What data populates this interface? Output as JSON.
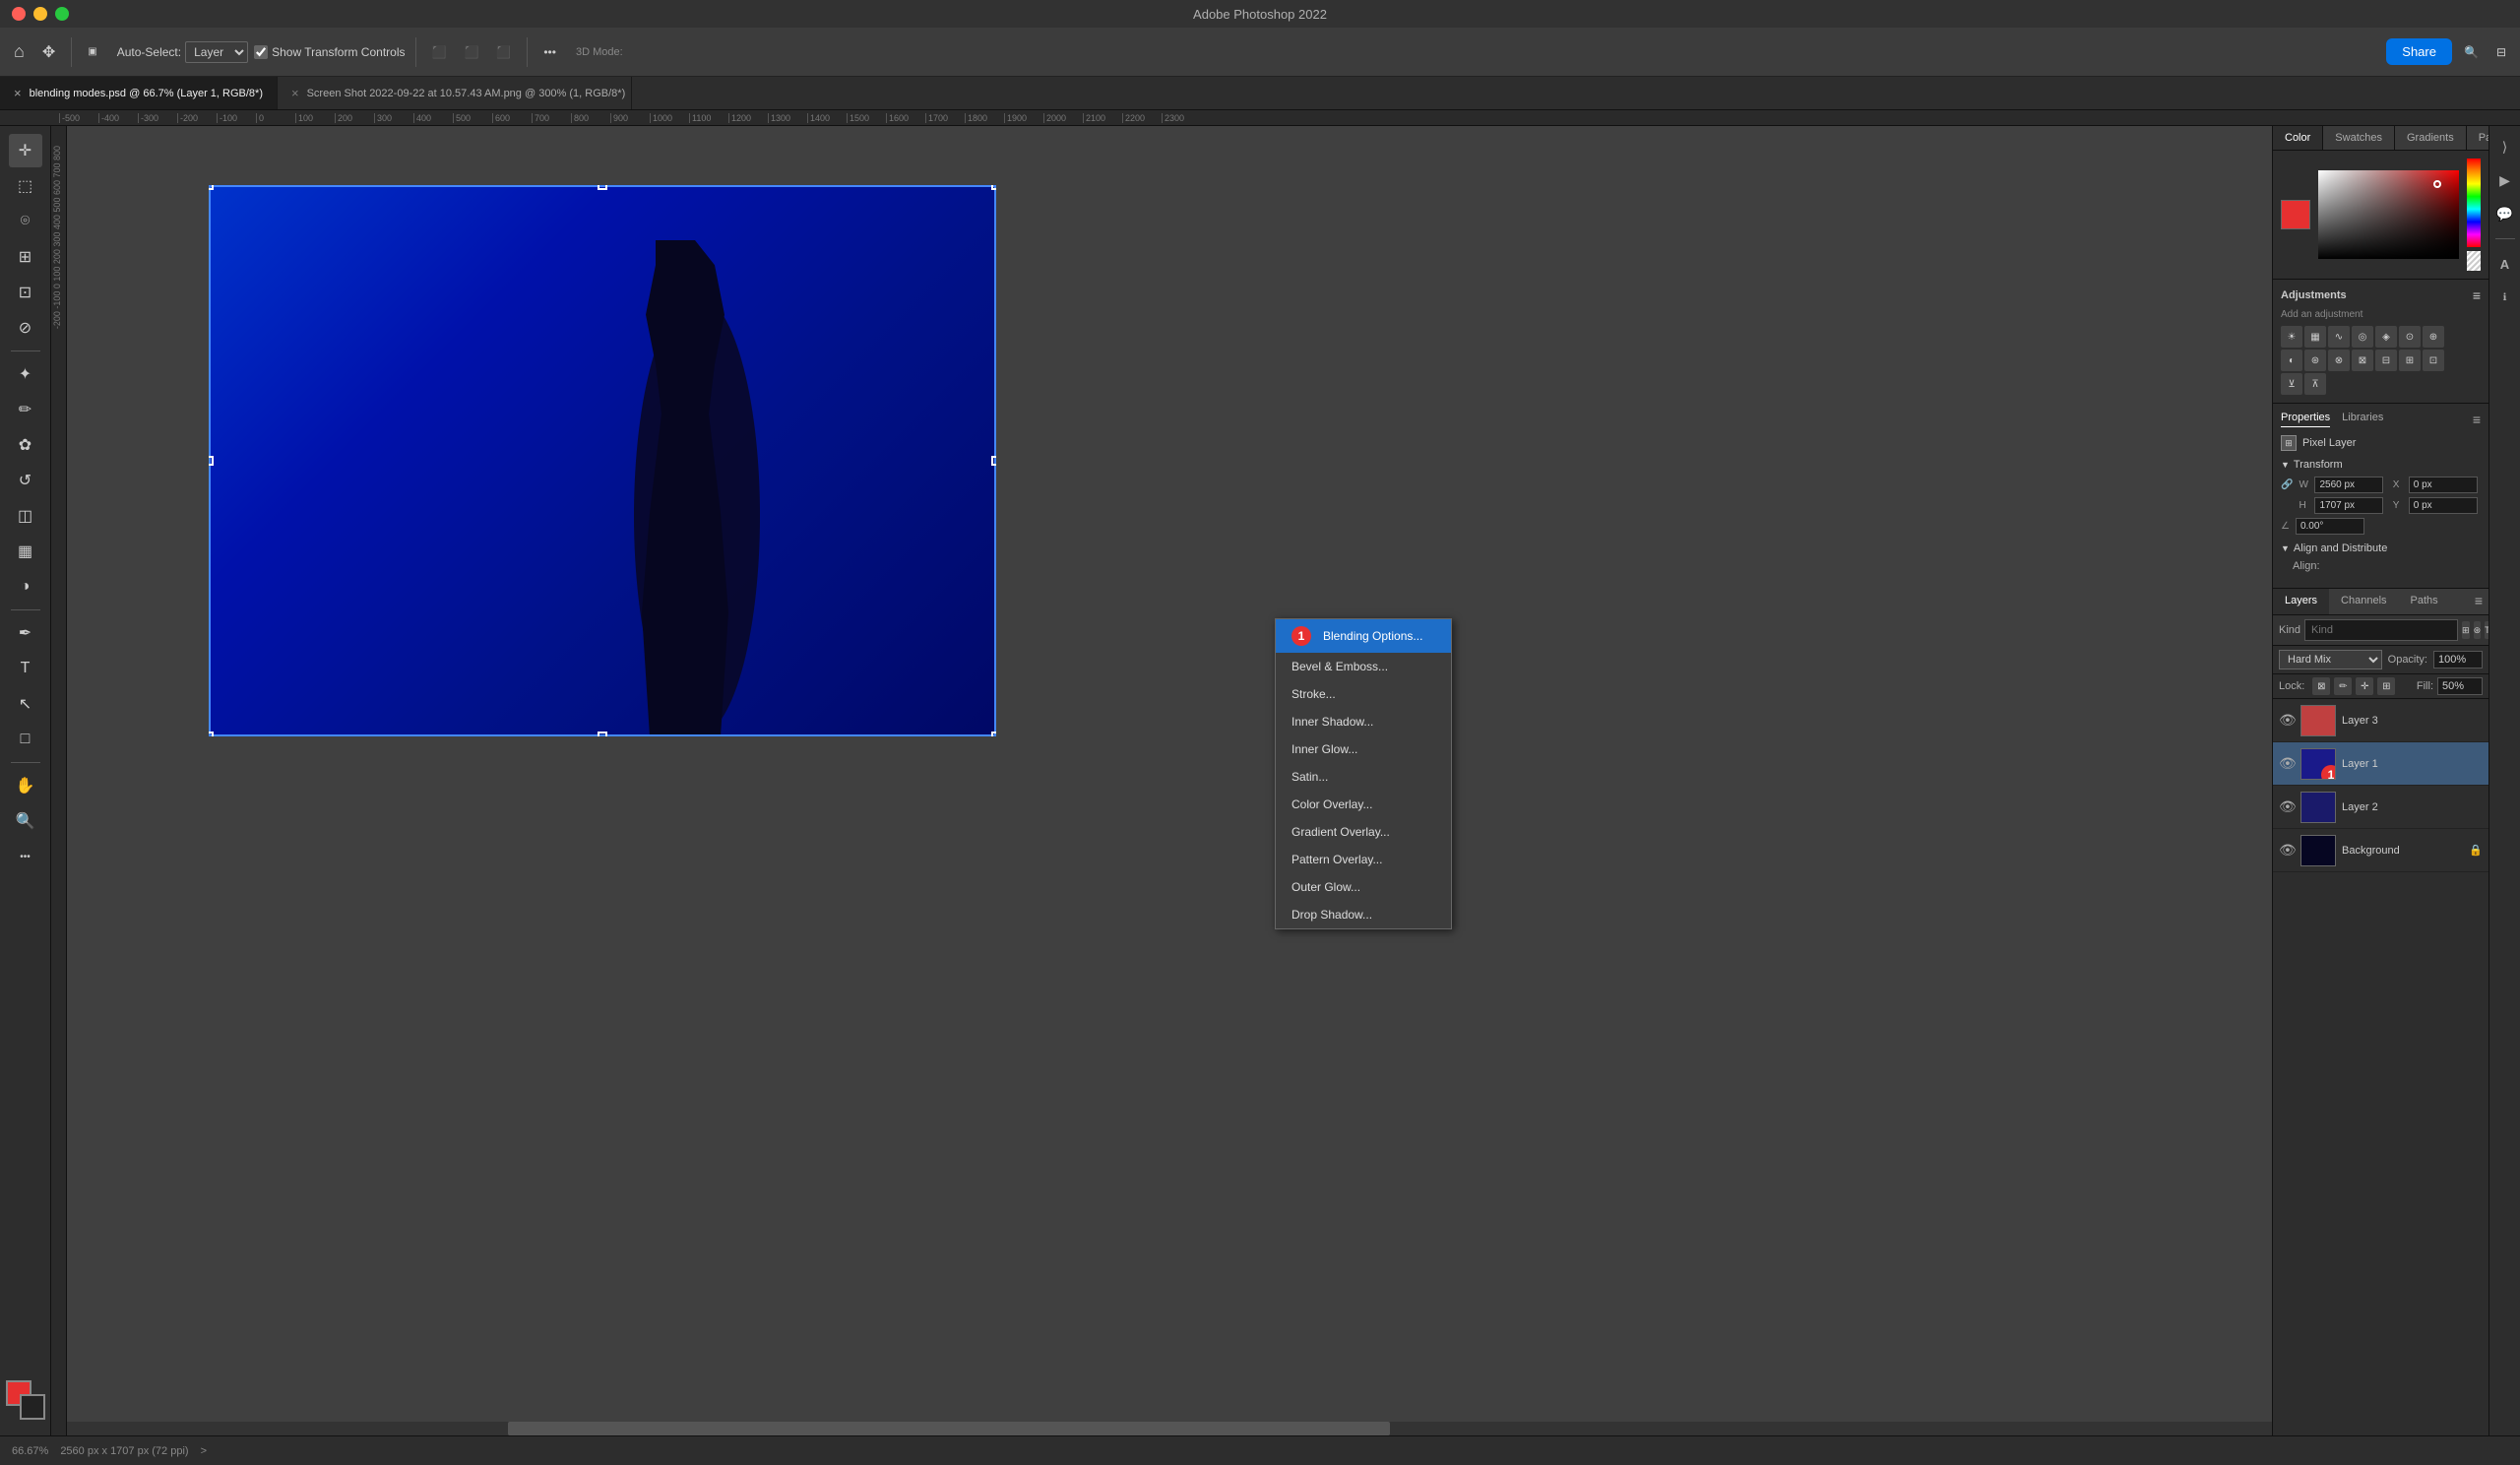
{
  "titleBar": {
    "title": "Adobe Photoshop 2022"
  },
  "toolbar": {
    "homeIcon": "⌂",
    "moveIcon": "✥",
    "autoSelectLabel": "Auto-Select:",
    "autoSelectValue": "Layer",
    "showTransformLabel": "Show Transform Controls",
    "threeDLabel": "3D Mode:",
    "moreIcon": "•••",
    "shareLabel": "Share"
  },
  "tabs": [
    {
      "id": "tab1",
      "label": "blending modes.psd @ 66.7% (Layer 1, RGB/8*)",
      "active": true,
      "modified": true
    },
    {
      "id": "tab2",
      "label": "Screen Shot 2022-09-22 at 10.57.43 AM.png @ 300% (1, RGB/8*)",
      "active": false,
      "modified": true
    }
  ],
  "ruler": {
    "marks": [
      "-500",
      "-400",
      "-300",
      "-200",
      "-100",
      "0",
      "100",
      "200",
      "300",
      "400",
      "500",
      "600",
      "700",
      "800",
      "900",
      "1000",
      "1100",
      "1200",
      "1300",
      "1400",
      "1500",
      "1600",
      "1700",
      "1800",
      "1900",
      "2000",
      "2100",
      "2200",
      "2300"
    ]
  },
  "colorPanel": {
    "tabs": [
      "Color",
      "Swatches",
      "Gradients",
      "Patterns"
    ],
    "activeTab": "Color"
  },
  "adjustments": {
    "title": "Adjustments",
    "addLabel": "Add an adjustment"
  },
  "properties": {
    "tabs": [
      "Properties",
      "Libraries"
    ],
    "activeTab": "Properties",
    "pixelLayerLabel": "Pixel Layer",
    "transform": {
      "title": "Transform",
      "w": "2560 px",
      "h": "1707 px",
      "x": "0 px",
      "y": "0 px",
      "angle": "0.00°"
    },
    "alignAndDistribute": {
      "title": "Align and Distribute",
      "alignLabel": "Align:"
    }
  },
  "layers": {
    "tabs": [
      "Layers",
      "Channels",
      "Paths"
    ],
    "activeTab": "Layers",
    "searchPlaceholder": "Kind",
    "blendMode": "Hard Mix",
    "opacity": "100%",
    "fill": "50%",
    "lockLabel": "Lock:",
    "items": [
      {
        "name": "Layer 3",
        "visible": true,
        "thumb": "red",
        "active": false
      },
      {
        "name": "Layer 1",
        "visible": true,
        "thumb": "blue",
        "active": true,
        "number": 1
      },
      {
        "name": "Layer 2",
        "visible": true,
        "thumb": "blue",
        "active": false
      },
      {
        "name": "Background",
        "visible": true,
        "thumb": "blue-dark",
        "active": false,
        "locked": true
      }
    ]
  },
  "contextMenu": {
    "items": [
      {
        "label": "Blending Options...",
        "highlighted": true,
        "hasNumber": true,
        "number": "1"
      },
      {
        "label": "Bevel & Emboss..."
      },
      {
        "label": "Stroke..."
      },
      {
        "label": "Inner Shadow..."
      },
      {
        "label": "Inner Glow..."
      },
      {
        "label": "Satin..."
      },
      {
        "label": "Color Overlay..."
      },
      {
        "label": "Gradient Overlay..."
      },
      {
        "label": "Pattern Overlay..."
      },
      {
        "label": "Outer Glow..."
      },
      {
        "label": "Drop Shadow..."
      }
    ]
  },
  "statusBar": {
    "zoom": "66.67%",
    "dimensions": "2560 px x 1707 px (72 ppi)",
    "arrowLabel": ">"
  }
}
